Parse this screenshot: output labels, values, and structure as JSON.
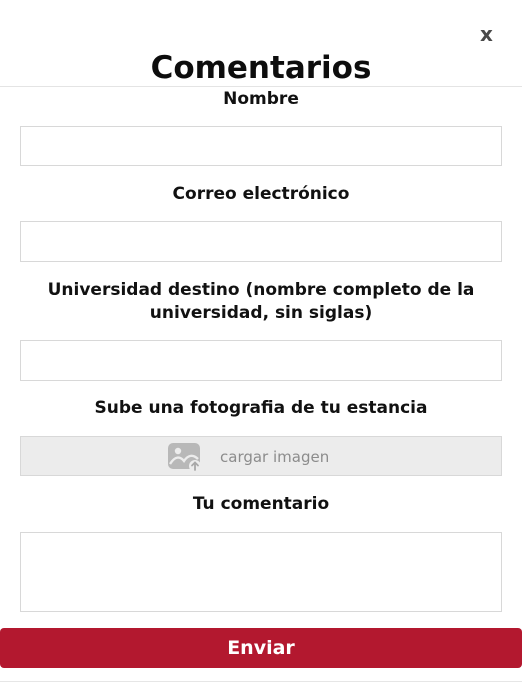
{
  "dialog": {
    "title": "Comentarios",
    "close_label": "x"
  },
  "form": {
    "name_label": "Nombre",
    "name_value": "",
    "email_label": "Correo electrónico",
    "email_value": "",
    "university_label": "Universidad destino (nombre completo de la universidad, sin siglas)",
    "university_value": "",
    "photo_label": "Sube una fotografia de tu estancia",
    "photo_button_label": "cargar imagen",
    "photo_icon": "image-upload-icon",
    "comment_label": "Tu comentario",
    "comment_value": "",
    "submit_label": "Enviar"
  },
  "colors": {
    "accent": "#b3182f",
    "upload_bg": "#ececec",
    "border": "#d8d8d8"
  }
}
